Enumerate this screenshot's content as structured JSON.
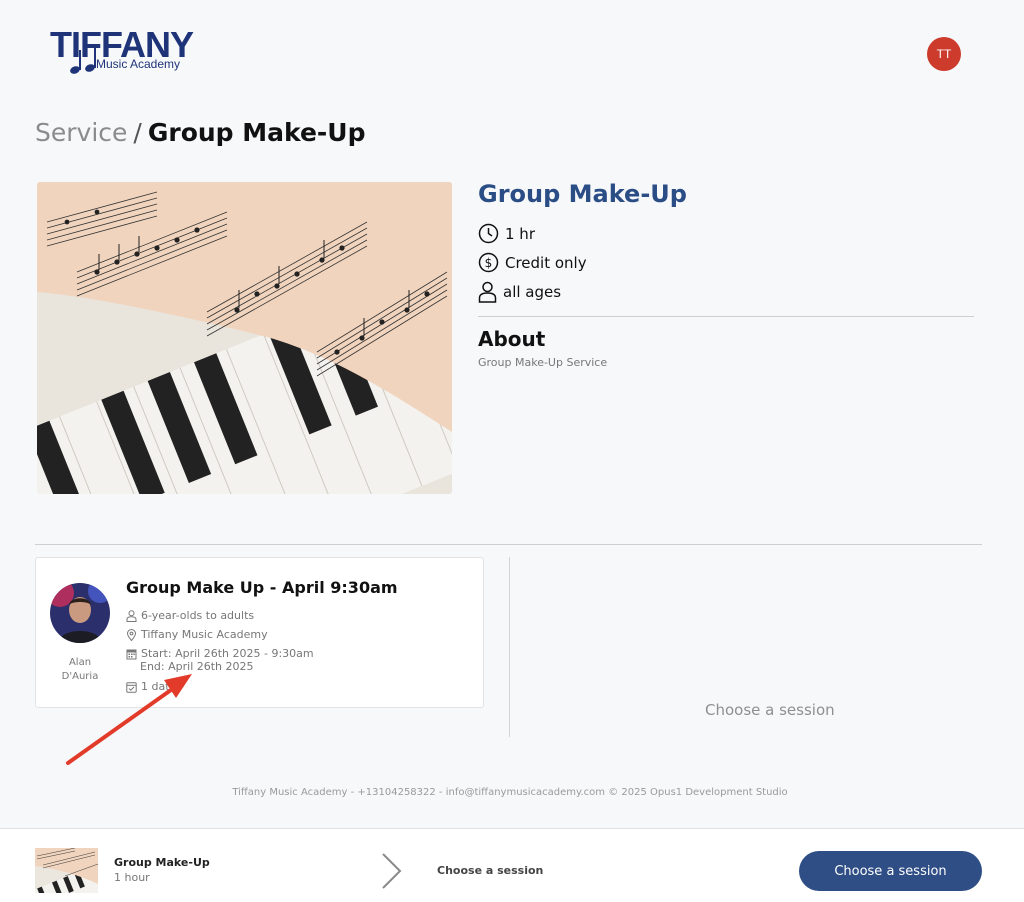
{
  "header": {
    "logo_title": "TIFFANY",
    "logo_subtitle": "Music Academy",
    "user_initials": "TT",
    "avatar_color": "#cc3b2b"
  },
  "breadcrumb": {
    "parent": "Service",
    "separator": "/",
    "current": "Group Make-Up"
  },
  "service": {
    "title": "Group Make-Up",
    "duration": "1 hr",
    "price": "Credit only",
    "ages": "all ages",
    "about_heading": "About",
    "about_text": "Group Make-Up Service",
    "title_color": "#2b4d86"
  },
  "session": {
    "title": "Group Make Up - April 9:30am",
    "ages": "6-year-olds to adults",
    "location": "Tiffany Music Academy",
    "start": "Start: April 26th 2025 - 9:30am",
    "end": "End: April 26th 2025",
    "dates": "1 date",
    "instructor": "Alan D'Auria"
  },
  "choose_placeholder": "Choose a session",
  "footer": {
    "text": "Tiffany Music Academy - +13104258322 - info@tiffanymusicacademy.com © 2025 Opus1 Development Studio"
  },
  "bottom_bar": {
    "service_title": "Group Make-Up",
    "service_duration": "1 hour",
    "step_label": "Choose a session",
    "button_label": "Choose a session",
    "button_color": "#2f4e85"
  },
  "icons": {
    "clock": "clock-icon",
    "dollar": "dollar-icon",
    "person": "person-icon",
    "map-pin": "map-pin-icon",
    "calendar": "calendar-icon",
    "calendar-check": "calendar-check-icon",
    "chevron": "chevron-right-icon"
  },
  "annotation": {
    "color": "#e23b2a"
  }
}
